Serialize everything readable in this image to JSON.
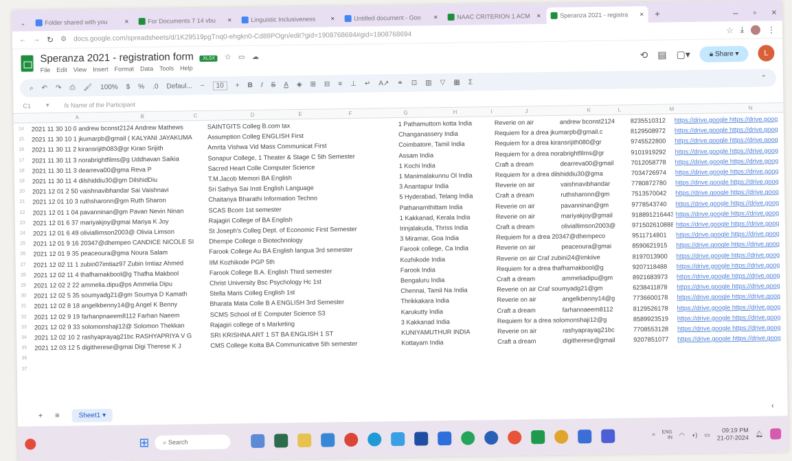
{
  "browser": {
    "tabs": [
      {
        "label": "Folder shared with you",
        "color": "#4285f4"
      },
      {
        "label": "For Documents 7 14 vbu",
        "color": "#1e8e3e"
      },
      {
        "label": "Linguistic Inclusiveness",
        "color": "#4285f4"
      },
      {
        "label": "Untitled document - Goo",
        "color": "#4285f4"
      },
      {
        "label": "NAAC CRITERION 1 ACM",
        "color": "#1e8e3e"
      },
      {
        "label": "Speranza 2021 - registra",
        "color": "#1e8e3e"
      }
    ],
    "url": "docs.google.com/spreadsheets/d/1K29519pgTnq0-ehgkn0-Cd88POgn/edit?gid=1908768694#gid=1908768694"
  },
  "doc": {
    "title": "Speranza 2021 - registration form",
    "badge": ".XLSX",
    "menus": [
      "File",
      "Edit",
      "View",
      "Insert",
      "Format",
      "Data",
      "Tools",
      "Help"
    ],
    "share_label": "Share",
    "avatar_letter": "L"
  },
  "toolbar": {
    "zoom": "100%",
    "font": "Defaul...",
    "font_size": "10"
  },
  "formula": {
    "cell_ref": "C1",
    "content": "Name of the Participant"
  },
  "columns": [
    "A",
    "B",
    "C",
    "D",
    "E",
    "F",
    "G",
    "H",
    "I",
    "J",
    "K",
    "L",
    "M",
    "N"
  ],
  "rows": [
    {
      "n": "14",
      "a": "2021 11 30 10 0 andrew bconst2124 Andrew Mathews",
      "c": "SAINTGITS Colleg B.com tax",
      "g": "1 Pathamuttom kotta India",
      "j": "Reverie on air",
      "k": "andrew bconst2124",
      "m": "8235510312"
    },
    {
      "n": "15",
      "a": "2021 11 30 10 1 jkumarpb@gmail ( KALYANI JAYAKUMA",
      "c": "Assumption Colleg ENGLISH      First",
      "g": "Changanassery    India",
      "j": "Requiem for a drea jkumarpb@gmail.c",
      "k": "",
      "m": "8129508972"
    },
    {
      "n": "16",
      "a": "2021 11 30 11 2 kiransrijith083@gr Kiran Srijith",
      "c": "Amrita Vishwa Vid Mass Communicat First",
      "g": "Coimbatore, Tamil India",
      "j": "Requiem for a drea kiransrijith080@gr",
      "k": "",
      "m": "9745522800"
    },
    {
      "n": "17",
      "a": "2021 11 30 11 3 norabrightfilms@g Uddhavan Saikia",
      "c": "Sonapur College, 1 Theater & Stage C 5th Semester",
      "g": "Assam            India",
      "j": "Requiem for a drea norabrightfilms@gr",
      "k": "",
      "m": "9101919292"
    },
    {
      "n": "18",
      "a": "2021 11 30 11 3 dearreva00@gma Reva P",
      "c": "Sacred Heart Colle Computer Science",
      "g": "1 Kochi           India",
      "j": "Craft a dream",
      "k": "dearreva00@gmail",
      "m": "7012058778"
    },
    {
      "n": "19",
      "a": "2021 11 30 11 4 dilshiddiu30@gm DilshidDiu",
      "c": "T.M.Jacob Memori BA English",
      "g": "1 Manimalakunnu Ol India",
      "j": "Requiem for a drea dilshiddiu30@gma",
      "k": "",
      "m": "7034726974"
    },
    {
      "n": "20",
      "a": "2021 12 01 2 50 vaishnavibhandar Sai Vaishnavi",
      "c": "Sri Sathya Sai Insti English Language",
      "g": "3 Anantapur       India",
      "j": "Reverie on air",
      "k": "vaishnavibhandar",
      "m": "7780872780"
    },
    {
      "n": "21",
      "a": "2021 12 01 10 3 ruthsharonn@gm Ruth Sharon",
      "c": "Chaitanya Bharathi Information Techno",
      "g": "5 Hyderabad, Telang India",
      "j": "Craft a dream",
      "k": "ruthsharonn@gm",
      "m": "7513570042"
    },
    {
      "n": "22",
      "a": "2021 12 01 1 04 pavanninan@gm Pavan Nevin Ninan",
      "c": "SCAS        Bcom         1st semester",
      "g": "Pathanamthittam  India",
      "j": "Reverie on air",
      "k": "pavanninan@gm",
      "m": "9778543740"
    },
    {
      "n": "23",
      "a": "2021 12 01 6 37 mariyakjoy@gmai Mariya K Joy",
      "c": "Rajagiri College of  BA English",
      "g": "1 Kakkanad, Kerala India",
      "j": "Reverie on air",
      "k": "mariyakjoy@gmail",
      "m": "918891216443"
    },
    {
      "n": "24",
      "a": "2021 12 01 6 49 oliviallimson2003@ Olivia Limson",
      "c": "St Joseph's Colleg Dept. of Economic First Semester",
      "g": "Irinjalakuda, Thriss India",
      "j": "Craft a dream",
      "k": "oliviallimson2003@",
      "m": "971502610888"
    },
    {
      "n": "25",
      "a": "2021 12 01 9 16 20347@dhempeo CANDICE NICOLE SI",
      "c": "Dhempe College o Biotechnology",
      "g": "3 Miramar, Goa    India",
      "j": "Requiem for a drea 20347@dhempeco",
      "k": "",
      "m": "9511714801"
    },
    {
      "n": "26",
      "a": "2021 12 01 9 35 peaceoura@gma Noura Salam",
      "c": "Farook College Au BA English langua 3rd semester",
      "g": "Farook college, Ca India",
      "j": "Reverie on air",
      "k": "peaceoura@gmai",
      "m": "8590621915"
    },
    {
      "n": "27",
      "a": "2021 12 02 11 1 zubin07imtiaz97 Zubin Imtiaz Ahmed",
      "c": "IIM Kozhikode    PGP         5th",
      "g": "Kozhikode        India",
      "j": "Reverie on air Craf zubini24@imkiive",
      "k": "",
      "m": "8197013900"
    },
    {
      "n": "28",
      "a": "2021 12 02 11 4 thafhamakbool@g Thafha Makbool",
      "c": "Farook College     B.A. English     Third semester",
      "g": "Farook           India",
      "j": "Requiem for a drea thafhamakbool@g",
      "k": "",
      "m": "9207118488"
    },
    {
      "n": "29",
      "a": "2021 12 02 2 22 ammelia.dipu@ps Ammelia Dipu",
      "c": "Christ University   Bsc Psychology Hc 1st",
      "g": "Bengaluru        India",
      "j": "Craft a dream",
      "k": "ammeliadipu@gm",
      "m": "8921683973"
    },
    {
      "n": "30",
      "a": "2021 12 02 5 35 soumyadg21@gm Soumya D Kamath",
      "c": "Stella Maris Colleg English        1st",
      "g": "Chennai, Tamil Na India",
      "j": "Reverie on air Craf soumyadg21@gm",
      "k": "",
      "m": "6238411878"
    },
    {
      "n": "31",
      "a": "2021 12 02 8 18 angelkbenny14@g Angel K Benny",
      "c": "Bharata Mata Colle B A ENGLISH     3rd Semester",
      "g": "Thrikkakara      India",
      "j": "Reverie on air",
      "k": "angelkbenny14@g",
      "m": "7736600178"
    },
    {
      "n": "32",
      "a": "2021 12 02 9 19 farhanpnaeem8112 Farhan Naeem",
      "c": "SCMS School of E Computer Science S3",
      "g": "Karukutty        India",
      "j": "Craft a dream",
      "k": "farhannaeem8112",
      "m": "8129526178"
    },
    {
      "n": "33",
      "a": "2021 12 02 9 33 solomonshaji12@ Solomon Thekkan",
      "c": "Rajagiri college of s Marketing",
      "g": "3 Kakkanad         India",
      "j": "Requiem for a drea solomonshaji12@g",
      "k": "",
      "m": "8589923519"
    },
    {
      "n": "34",
      "a": "2021 12 02 10 2 rashyaprayag21bc RASHYAPRIYA V G",
      "c": "SRI KRISHNA ART 1 ST BA ENGLISH 1 ST",
      "g": "KUNIYAMUTHUR  INDIA",
      "j": "Reverie on air",
      "k": "rashyaprayag21bc",
      "m": "7708553128"
    },
    {
      "n": "35",
      "a": "2021 12 03 12 5 digitherese@gmai Digi Therese K J",
      "c": "CMS College Kotta BA Communicative 5th semester",
      "g": "Kottayam         India",
      "j": "Craft a dream",
      "k": "digitherese@gmail",
      "m": "9207851077"
    },
    {
      "n": "36",
      "a": "",
      "c": "",
      "g": "",
      "j": "",
      "k": "",
      "m": ""
    },
    {
      "n": "37",
      "a": "",
      "c": "",
      "g": "",
      "j": "",
      "k": "",
      "m": ""
    }
  ],
  "link_text": "https://drive.google https://drive.google",
  "sheet": {
    "tab_label": "Sheet1"
  },
  "taskbar": {
    "search_placeholder": "Search",
    "lang": "ENG\nIN",
    "time": "09:19 PM",
    "date": "21-07-2024"
  },
  "colors": {
    "accent_green": "#1e8e3e",
    "share_blue": "#c2e7ff",
    "tab_bar": "#e8dff3",
    "link_blue": "#4a7fd8"
  }
}
